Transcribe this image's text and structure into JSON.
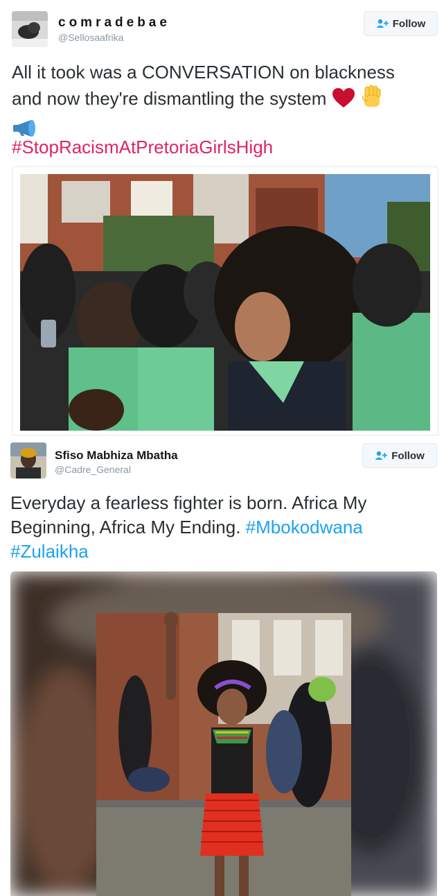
{
  "tweet1": {
    "display_name": "comradebae",
    "handle": "@Sellosaafrika",
    "follow_label": "Follow",
    "text": "All it took was a CONVERSATION on blackness and now they're dismantling the system",
    "emoji": [
      "red-heart",
      "raised-fist",
      "megaphone"
    ],
    "hashtag": "#StopRacismAtPretoriaGirlsHigh",
    "hashtag_color": "#e0245e"
  },
  "tweet2": {
    "display_name": "Sfiso Mabhiza Mbatha",
    "handle": "@Cadre_General",
    "follow_label": "Follow",
    "text": "Everyday a fearless fighter is born. Africa My Beginning, Africa My Ending.",
    "hashtags": [
      "#Mbokodwana",
      "#Zulaikha"
    ],
    "hashtag_color": "#1da1f2"
  },
  "colors": {
    "text": "#292f33",
    "muted": "#8899a6",
    "follow_icon": "#1da1f2"
  }
}
